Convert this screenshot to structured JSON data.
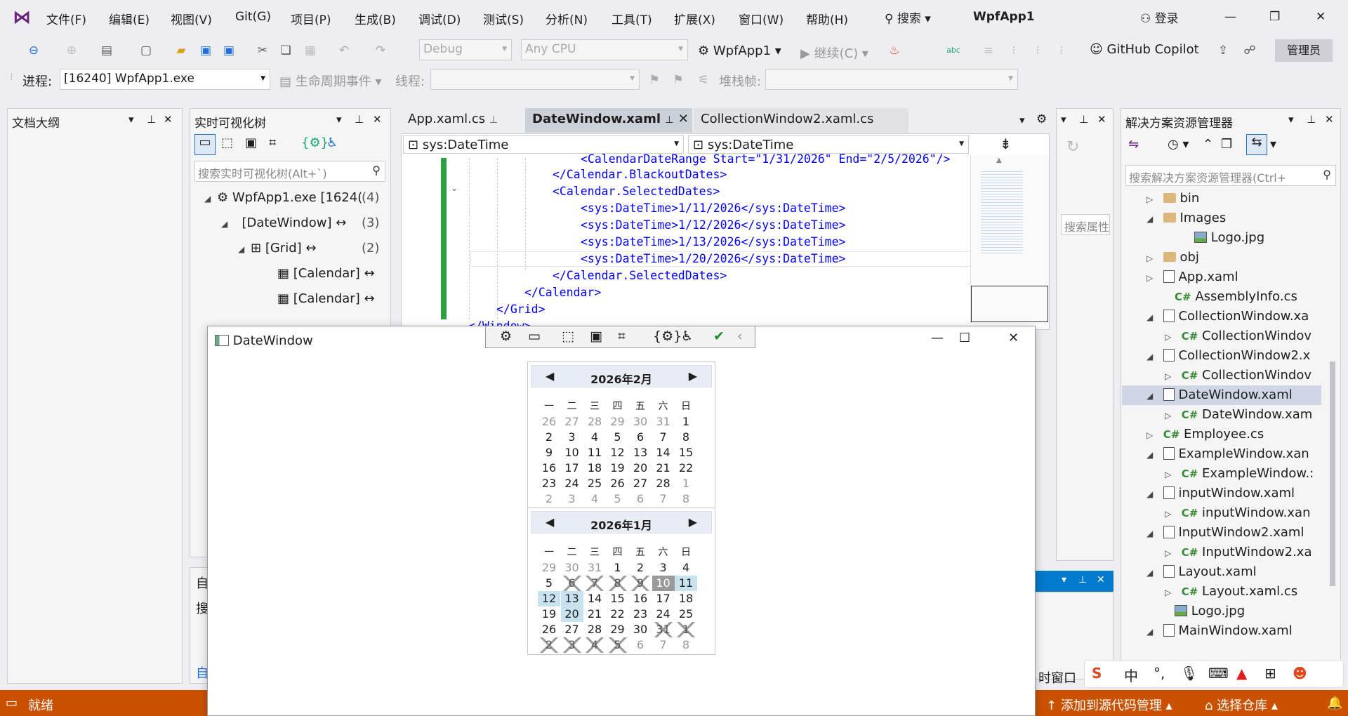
{
  "menubar": {
    "items": [
      "文件(F)",
      "编辑(E)",
      "视图(V)",
      "Git(G)",
      "项目(P)",
      "生成(B)",
      "调试(D)",
      "测试(S)",
      "分析(N)",
      "工具(T)",
      "扩展(X)",
      "窗口(W)",
      "帮助(H)"
    ],
    "search_label": "搜索",
    "app_title": "WpfApp1",
    "login_label": "登录"
  },
  "toolbar": {
    "config": "Debug",
    "platform": "Any CPU",
    "startup_project": "WpfApp1",
    "continue_label": "继续(C)",
    "copilot_label": "GitHub Copilot",
    "admin_label": "管理员"
  },
  "toolbar2": {
    "process_label": "进程:",
    "process_value": "[16240] WpfApp1.exe",
    "lifecycle_label": "生命周期事件",
    "thread_label": "线程:",
    "stackframe_label": "堆栈帧:"
  },
  "doc_outline": {
    "title": "文档大纲"
  },
  "live_tree": {
    "title": "实时可视化树",
    "search_placeholder": "搜索实时可视化树(Alt+`)",
    "rows": [
      {
        "label": "WpfApp1.exe [1624(",
        "count": "(4)"
      },
      {
        "label": "[DateWindow]",
        "count": "(3)"
      },
      {
        "label": "[Grid]",
        "count": "(2)"
      },
      {
        "label": "[Calendar]",
        "count": ""
      },
      {
        "label": "[Calendar]",
        "count": ""
      }
    ],
    "bottom_label_1": "自",
    "bottom_label_2": "搜",
    "bottom_label_3": "自"
  },
  "tabs": [
    {
      "label": "App.xaml.cs"
    },
    {
      "label": "DateWindow.xaml"
    },
    {
      "label": "CollectionWindow2.xaml.cs"
    }
  ],
  "editor": {
    "nav_left": "sys:DateTime",
    "nav_right": "sys:DateTime",
    "lines": [
      "<CalendarDateRange Start=\"1/31/2026\" End=\"2/5/2026\"/>",
      "</Calendar.BlackoutDates>",
      "<Calendar.SelectedDates>",
      "<sys:DateTime>1/11/2026</sys:DateTime>",
      "<sys:DateTime>1/12/2026</sys:DateTime>",
      "<sys:DateTime>1/13/2026</sys:DateTime>",
      "<sys:DateTime>1/20/2026</sys:DateTime>",
      "</Calendar.SelectedDates>",
      "</Calendar>",
      "</Grid>",
      "</Window>"
    ]
  },
  "properties": {
    "search_placeholder": "搜索属性"
  },
  "datewindow": {
    "title": "DateWindow",
    "feb": {
      "title": "2026年2月",
      "days_header": [
        "一",
        "二",
        "三",
        "四",
        "五",
        "六",
        "日"
      ],
      "days": [
        [
          "26",
          "27",
          "28",
          "29",
          "30",
          "31",
          "1"
        ],
        [
          "2",
          "3",
          "4",
          "5",
          "6",
          "7",
          "8"
        ],
        [
          "9",
          "10",
          "11",
          "12",
          "13",
          "14",
          "15"
        ],
        [
          "16",
          "17",
          "18",
          "19",
          "20",
          "21",
          "22"
        ],
        [
          "23",
          "24",
          "25",
          "26",
          "27",
          "28",
          "1"
        ],
        [
          "2",
          "3",
          "4",
          "5",
          "6",
          "7",
          "8"
        ]
      ]
    },
    "jan": {
      "title": "2026年1月",
      "days_header": [
        "一",
        "二",
        "三",
        "四",
        "五",
        "六",
        "日"
      ],
      "days": [
        [
          "29",
          "30",
          "31",
          "1",
          "2",
          "3",
          "4"
        ],
        [
          "5",
          "6",
          "7",
          "8",
          "9",
          "10",
          "11"
        ],
        [
          "12",
          "13",
          "14",
          "15",
          "16",
          "17",
          "18"
        ],
        [
          "19",
          "20",
          "21",
          "22",
          "23",
          "24",
          "25"
        ],
        [
          "26",
          "27",
          "28",
          "29",
          "30",
          "31",
          "1"
        ],
        [
          "2",
          "3",
          "4",
          "5",
          "6",
          "7",
          "8"
        ]
      ]
    }
  },
  "solution_explorer": {
    "title": "解决方案资源管理器",
    "search_placeholder": "搜索解决方案资源管理器(Ctrl+",
    "rows": [
      {
        "label": "bin"
      },
      {
        "label": "Images"
      },
      {
        "label": "Logo.jpg"
      },
      {
        "label": "obj"
      },
      {
        "label": "App.xaml"
      },
      {
        "label": "AssemblyInfo.cs"
      },
      {
        "label": "CollectionWindow.xa"
      },
      {
        "label": "CollectionWindov"
      },
      {
        "label": "CollectionWindow2.x"
      },
      {
        "label": "CollectionWindov"
      },
      {
        "label": "DateWindow.xaml"
      },
      {
        "label": "DateWindow.xam"
      },
      {
        "label": "Employee.cs"
      },
      {
        "label": "ExampleWindow.xan"
      },
      {
        "label": "ExampleWindow.:"
      },
      {
        "label": "inputWindow.xaml"
      },
      {
        "label": "inputWindow.xan"
      },
      {
        "label": "InputWindow2.xaml"
      },
      {
        "label": "InputWindow2.xa"
      },
      {
        "label": "Layout.xaml"
      },
      {
        "label": "Layout.xaml.cs"
      },
      {
        "label": "Logo.jpg"
      },
      {
        "label": "MainWindow.xaml"
      }
    ]
  },
  "statusbar": {
    "ready": "就绪",
    "source_control": "添加到源代码管理",
    "select_repo": "选择仓库",
    "partial_window": "时窗口"
  },
  "ime": {
    "lang": "中"
  },
  "colors": {
    "status": "#ca5100",
    "accent": "#007acc"
  }
}
